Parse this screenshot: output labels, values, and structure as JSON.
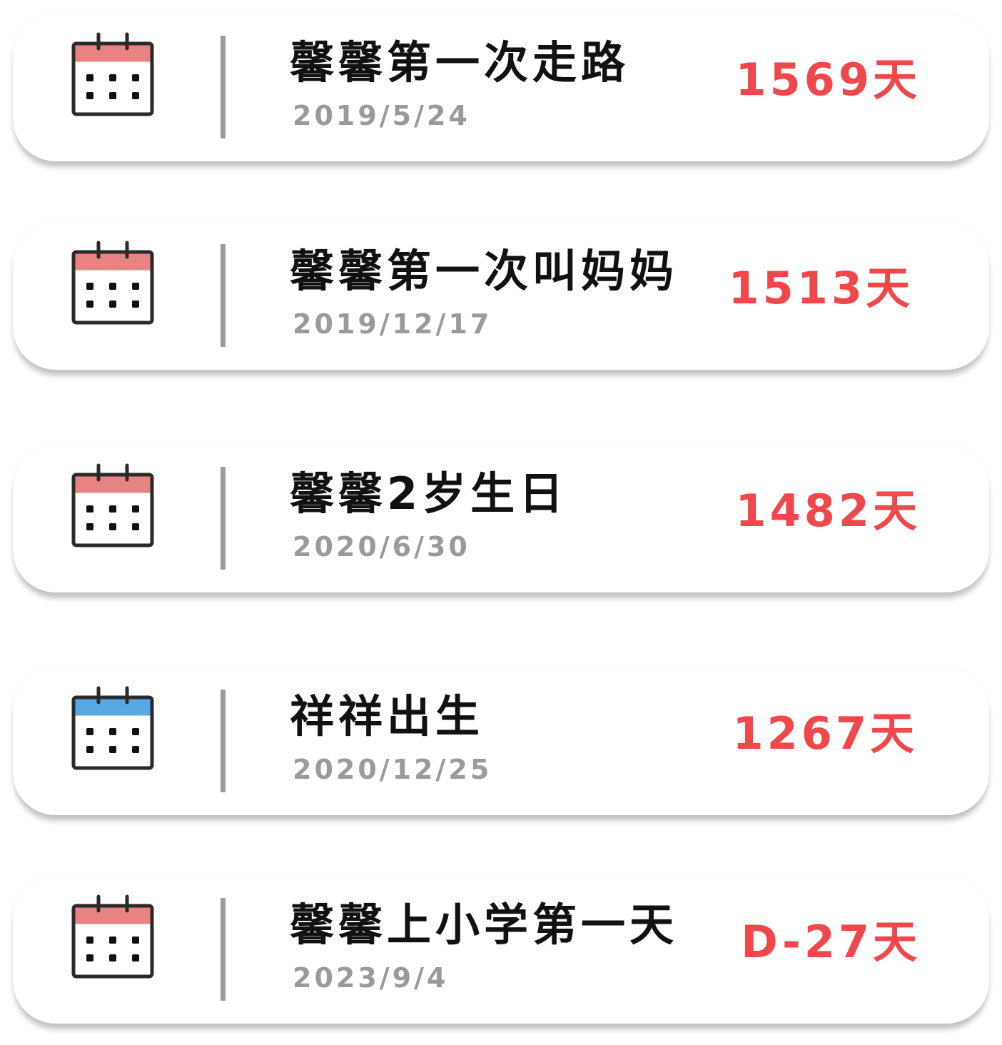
{
  "colors": {
    "count": "#f0474a",
    "calendar_header_red": "#e88383",
    "calendar_header_blue": "#5aa7e6",
    "divider": "#9c9c9c",
    "date": "#9a9a9a"
  },
  "events": [
    {
      "title": "馨馨第一次走路",
      "date": "2019/5/24",
      "count": "1569天",
      "icon": "calendar-icon",
      "header_color": "#e88383"
    },
    {
      "title": "馨馨第一次叫妈妈",
      "date": "2019/12/17",
      "count": "1513天",
      "icon": "calendar-icon",
      "header_color": "#e88383"
    },
    {
      "title": "馨馨2岁生日",
      "date": "2020/6/30",
      "count": "1482天",
      "icon": "calendar-icon",
      "header_color": "#e88383"
    },
    {
      "title": "祥祥出生",
      "date": "2020/12/25",
      "count": "1267天",
      "icon": "calendar-icon",
      "header_color": "#5aa7e6"
    },
    {
      "title": "馨馨上小学第一天",
      "date": "2023/9/4",
      "count": "D-27天",
      "icon": "calendar-icon",
      "header_color": "#e88383"
    }
  ]
}
